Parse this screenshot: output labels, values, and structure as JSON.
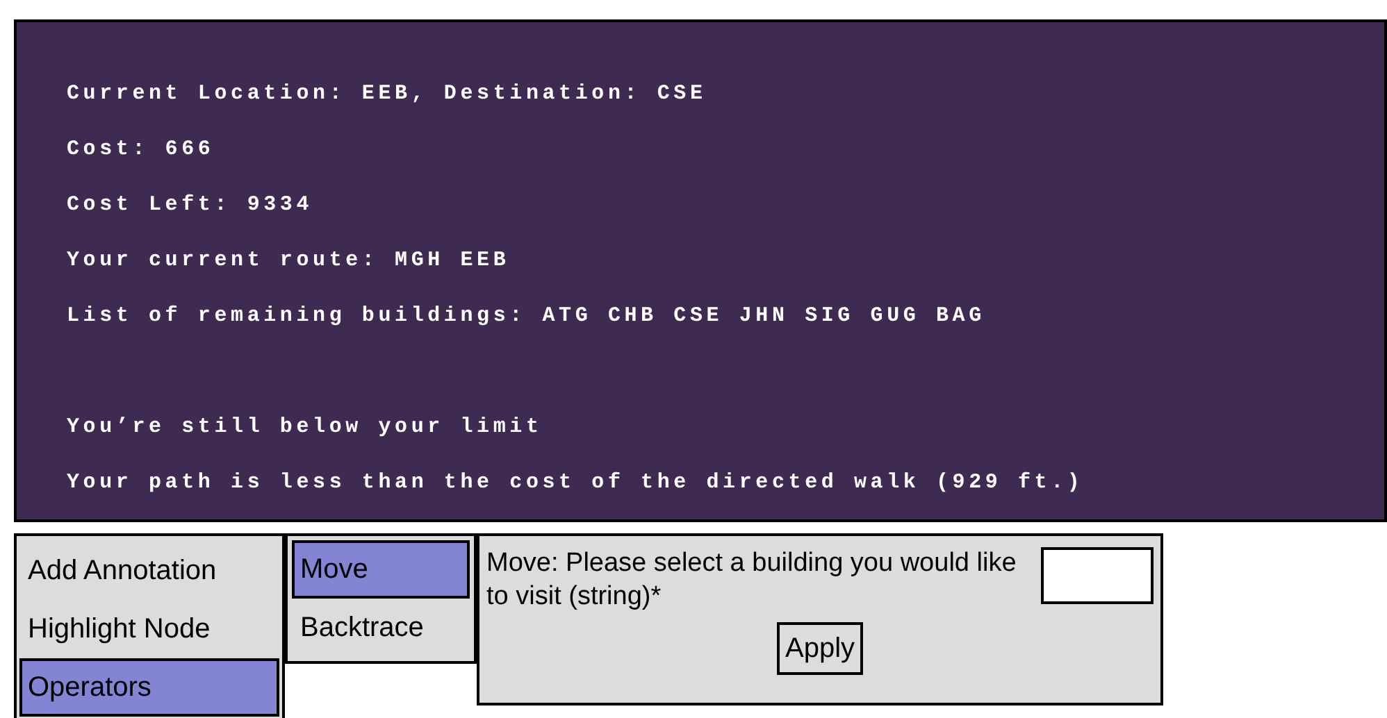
{
  "status_panel": {
    "lines": [
      "Current Location: EEB, Destination: CSE",
      "Cost: 666",
      "Cost Left: 9334",
      "Your current route: MGH EEB",
      "List of remaining buildings: ATG CHB CSE JHN SIG GUG BAG"
    ],
    "messages": [
      "You’re still below your limit",
      "Your path is less than the cost of the directed walk (929 ft.)"
    ]
  },
  "menu": [
    {
      "label": "Add Annotation",
      "selected": false
    },
    {
      "label": "Highlight Node",
      "selected": false
    },
    {
      "label": "Operators",
      "selected": true
    }
  ],
  "submenu": [
    {
      "label": "Move",
      "selected": true
    },
    {
      "label": "Backtrace",
      "selected": false
    }
  ],
  "form": {
    "prompt": "Move: Please select a building you would like to visit (string)*",
    "button": "Apply"
  }
}
